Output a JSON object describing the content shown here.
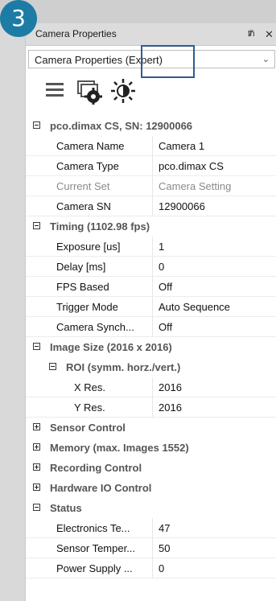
{
  "badge": "3",
  "window": {
    "title": "Camera Properties",
    "pin_icon": "pin-icon",
    "close_icon": "close-icon"
  },
  "combo": {
    "value": "Camera Properties (Expert)",
    "arrow_icon": "chevron-down-icon"
  },
  "toolbar": [
    {
      "icon": "list-icon"
    },
    {
      "icon": "camera-settings-icon"
    },
    {
      "icon": "brightness-icon"
    }
  ],
  "grid": {
    "cat_camera": "pco.dimax CS, SN: 12900066",
    "camera_name_label": "Camera Name",
    "camera_name_value": "Camera 1",
    "camera_type_label": "Camera Type",
    "camera_type_value": "pco.dimax CS",
    "current_set_label": "Current Set",
    "current_set_value": "Camera Setting",
    "camera_sn_label": "Camera SN",
    "camera_sn_value": "12900066",
    "cat_timing": "Timing (1102.98 fps)",
    "exposure_label": "Exposure [us]",
    "exposure_value": "1",
    "delay_label": "Delay [ms]",
    "delay_value": "0",
    "fps_based_label": "FPS Based",
    "fps_based_value": "Off",
    "trigger_mode_label": "Trigger Mode",
    "trigger_mode_value": "Auto Sequence",
    "camera_synch_label": "Camera Synch...",
    "camera_synch_value": "Off",
    "cat_image_size": "Image Size (2016 x 2016)",
    "cat_roi": "ROI (symm. horz./vert.)",
    "x_res_label": "X Res.",
    "x_res_value": "2016",
    "y_res_label": "Y Res.",
    "y_res_value": "2016",
    "cat_sensor_control": "Sensor Control",
    "cat_memory": "Memory (max. Images 1552)",
    "cat_recording": "Recording Control",
    "cat_hardware_io": "Hardware IO Control",
    "cat_status": "Status",
    "electronics_temp_label": "Electronics Te...",
    "electronics_temp_value": "47",
    "sensor_temp_label": "Sensor Temper...",
    "sensor_temp_value": "50",
    "power_supply_label": "Power Supply ...",
    "power_supply_value": "0"
  }
}
